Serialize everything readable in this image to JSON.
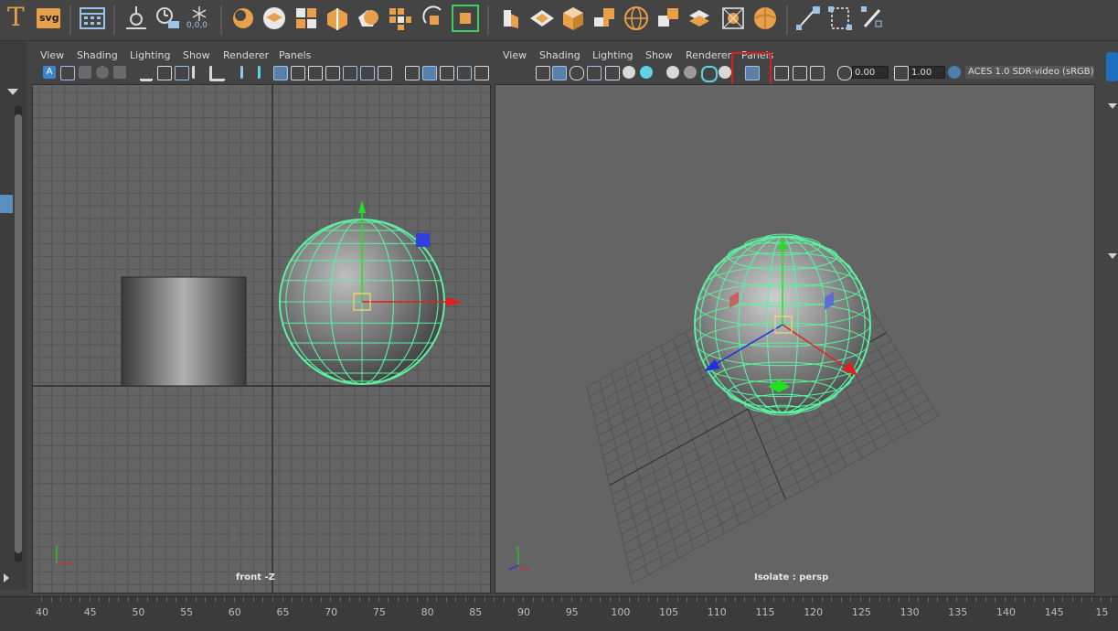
{
  "shelf": {
    "tools": [
      {
        "icon": "text-tool-icon",
        "glyph": "T"
      },
      {
        "icon": "svg-tool-icon",
        "glyph": "svg"
      },
      {
        "icon": "type-layout-icon"
      },
      {
        "icon": "measure-tool-icon"
      },
      {
        "icon": "snap-tool-icon"
      },
      {
        "icon": "snowflake-icon",
        "glyph": "0,0,0"
      },
      {
        "icon": "lattice-icon"
      },
      {
        "icon": "polygon-layer-icon"
      },
      {
        "icon": "cube-split-icon"
      },
      {
        "icon": "extrude-icon"
      },
      {
        "icon": "smooth-icon"
      },
      {
        "icon": "split-polygon-icon"
      },
      {
        "icon": "rotate-icon"
      },
      {
        "icon": "paint-select-icon"
      },
      {
        "icon": "bevel-icon"
      },
      {
        "icon": "plane-icon"
      },
      {
        "icon": "cube-icon"
      },
      {
        "icon": "connect-icon"
      },
      {
        "icon": "sphere-wire-icon"
      },
      {
        "icon": "cube-flip-icon"
      },
      {
        "icon": "layer-stack-icon"
      },
      {
        "icon": "bounding-box-icon"
      },
      {
        "icon": "sphere-color-icon"
      },
      {
        "icon": "curve-tool-icon"
      },
      {
        "icon": "resize-tool-icon"
      },
      {
        "icon": "brush-tool-icon"
      }
    ]
  },
  "left_panel": {
    "menus": [
      "View",
      "Shading",
      "Lighting",
      "Show",
      "Renderer",
      "Panels"
    ],
    "camera_label": "front -Z"
  },
  "right_panel": {
    "menus": [
      "View",
      "Shading",
      "Lighting",
      "Show",
      "Renderer",
      "Panels"
    ],
    "exposure_value": "0.00",
    "gamma_value": "1.00",
    "color_space": "ACES 1.0 SDR-video (sRGB)",
    "camera_label": "Isolate : persp"
  },
  "timeline": {
    "ticks": [
      "40",
      "45",
      "50",
      "55",
      "60",
      "65",
      "70",
      "75",
      "80",
      "85",
      "90",
      "95",
      "100",
      "105",
      "110",
      "115",
      "120",
      "125",
      "130",
      "135",
      "140",
      "145",
      "15"
    ]
  },
  "colors": {
    "background": "#444444",
    "viewport": "#646464",
    "grid_line": "#535353",
    "wireframe": "#5cf0a0",
    "highlight_box": "#d42020"
  }
}
